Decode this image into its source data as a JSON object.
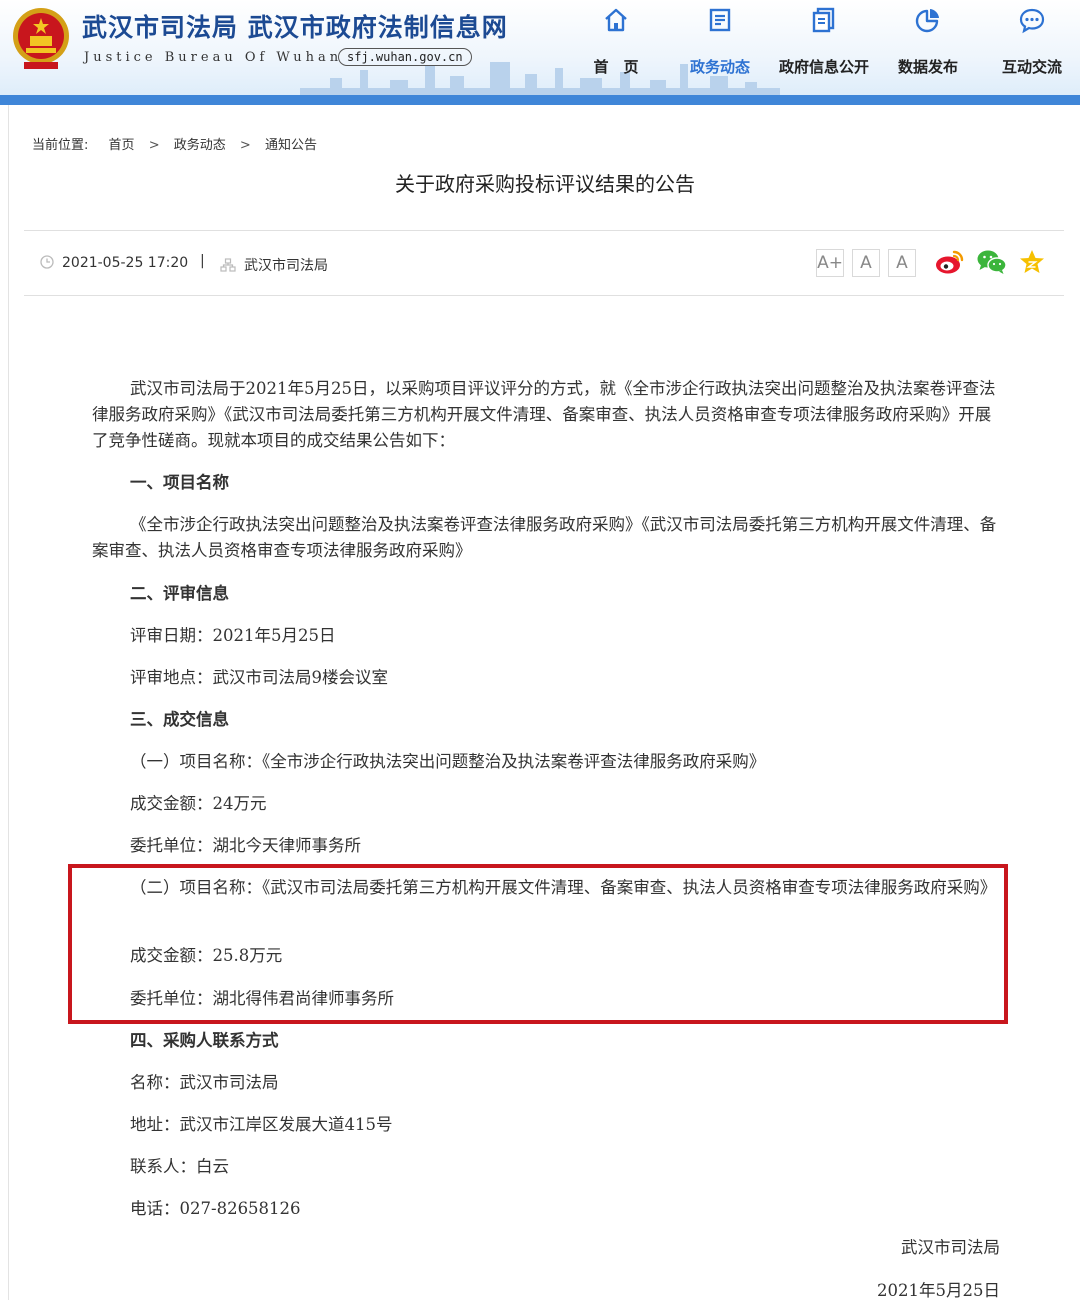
{
  "header": {
    "site_title": "武汉市司法局 武汉市政府法制信息网",
    "site_english": "Justice Bureau Of Wuhan",
    "site_url": "sfj.wuhan.gov.cn",
    "nav": [
      {
        "label": "首　页",
        "icon": "home-icon"
      },
      {
        "label": "政务动态",
        "icon": "news-icon",
        "active": true
      },
      {
        "label": "政府信息公开",
        "icon": "documents-icon"
      },
      {
        "label": "数据发布",
        "icon": "pie-chart-icon"
      },
      {
        "label": "互动交流",
        "icon": "chat-bubble-icon"
      }
    ],
    "accent_color": "#2d72d2",
    "title_color": "#1c4a93"
  },
  "breadcrumb": {
    "prefix": "当前位置:",
    "items": [
      "首页",
      "政务动态",
      "通知公告"
    ],
    "separator": ">"
  },
  "article": {
    "title": "关于政府采购投标评议结果的公告",
    "meta": {
      "datetime": "2021-05-25 17:20",
      "divider": "|",
      "source": "武汉市司法局"
    },
    "font_sizes": [
      "A+",
      "A",
      "A"
    ],
    "share": [
      "weibo-icon",
      "wechat-icon",
      "favorite-star-icon"
    ],
    "intro": "武汉市司法局于2021年5月25日，以采购项目评议评分的方式，就《全市涉企行政执法突出问题整治及执法案卷评查法律服务政府采购》《武汉市司法局委托第三方机构开展文件清理、备案审查、执法人员资格审查专项法律服务政府采购》开展了竞争性磋商。现就本项目的成交结果公告如下：",
    "section1_heading": "一、项目名称",
    "section1_text": "《全市涉企行政执法突出问题整治及执法案卷评查法律服务政府采购》《武汉市司法局委托第三方机构开展文件清理、备案审查、执法人员资格审查专项法律服务政府采购》",
    "section2_heading": "二、评审信息",
    "review_date": "评审日期：2021年5月25日",
    "review_place": "评审地点：武汉市司法局9楼会议室",
    "section3_heading": "三、成交信息",
    "deal1_name": "（一）项目名称：《全市涉企行政执法突出问题整治及执法案卷评查法律服务政府采购》",
    "deal1_amount": "成交金额：24万元",
    "deal1_unit": "委托单位：湖北今天律师事务所",
    "deal2_name": "（二）项目名称：《武汉市司法局委托第三方机构开展文件清理、备案审查、执法人员资格审查专项法律服务政府采购》",
    "deal2_amount": "成交金额：25.8万元",
    "deal2_unit": "委托单位：湖北得伟君尚律师事务所",
    "section4_heading": "四、采购人联系方式",
    "contact_name": "名称：武汉市司法局",
    "contact_address": "地址：武汉市江岸区发展大道415号",
    "contact_person": "联系人：白云",
    "contact_phone": "电话：027-82658126",
    "signature_org": "武汉市司法局",
    "signature_date": "2021年5月25日",
    "highlight_color": "#c8161d"
  }
}
